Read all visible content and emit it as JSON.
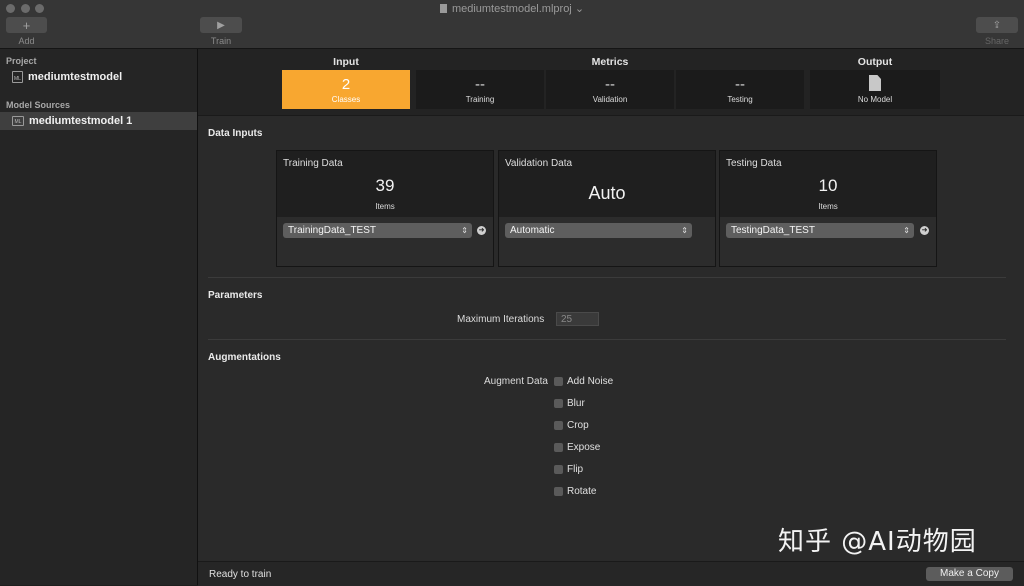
{
  "window": {
    "title": "mediumtestmodel.mlproj"
  },
  "toolbar": {
    "add_label": "Add",
    "train_label": "Train",
    "share_label": "Share"
  },
  "sidebar": {
    "project_header": "Project",
    "project_item": "mediumtestmodel",
    "sources_header": "Model Sources",
    "source_item": "mediumtestmodel 1"
  },
  "summary": {
    "input": {
      "title": "Input",
      "value": "2",
      "label": "Classes"
    },
    "metrics": {
      "title": "Metrics",
      "tiles": [
        {
          "value": "--",
          "label": "Training"
        },
        {
          "value": "--",
          "label": "Validation"
        },
        {
          "value": "--",
          "label": "Testing"
        }
      ]
    },
    "output": {
      "title": "Output",
      "label": "No Model"
    }
  },
  "data_inputs": {
    "heading": "Data Inputs",
    "training": {
      "title": "Training Data",
      "count": "39",
      "unit": "Items",
      "source": "TrainingData_TEST"
    },
    "validation": {
      "title": "Validation Data",
      "value": "Auto",
      "source": "Automatic"
    },
    "testing": {
      "title": "Testing Data",
      "count": "10",
      "unit": "Items",
      "source": "TestingData_TEST"
    }
  },
  "parameters": {
    "heading": "Parameters",
    "max_iterations_label": "Maximum Iterations",
    "max_iterations_placeholder": "25"
  },
  "augmentations": {
    "heading": "Augmentations",
    "label": "Augment Data",
    "options": [
      "Add Noise",
      "Blur",
      "Crop",
      "Expose",
      "Flip",
      "Rotate"
    ]
  },
  "status": {
    "text": "Ready to train",
    "make_copy_label": "Make a Copy"
  },
  "watermark": {
    "text": "知乎 @AI动物园"
  },
  "colors": {
    "accent": "#f8a730"
  }
}
